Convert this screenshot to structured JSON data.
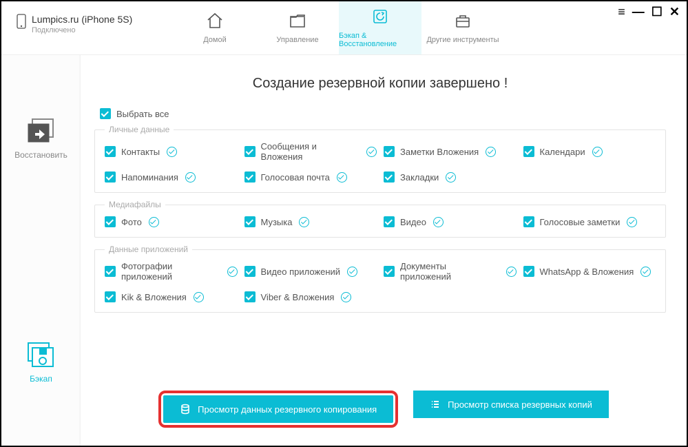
{
  "device": {
    "name": "Lumpics.ru (iPhone 5S)",
    "status": "Подключено"
  },
  "nav": {
    "home": "Домой",
    "manage": "Управление",
    "backup": "Бэкап & Восстановление",
    "tools": "Другие инструменты"
  },
  "sidebar": {
    "restore": "Восстановить",
    "backup": "Бэкап"
  },
  "headline": "Создание резервной копии завершено !",
  "select_all": "Выбрать все",
  "groups": {
    "personal": {
      "title": "Личные данные",
      "items": {
        "contacts": "Контакты",
        "messages": "Сообщения и Вложения",
        "notes_att": "Заметки Вложения",
        "calendars": "Календари",
        "reminders": "Напоминания",
        "voicemail": "Голосовая почта",
        "bookmarks": "Закладки"
      }
    },
    "media": {
      "title": "Медиафайлы",
      "items": {
        "photo": "Фото",
        "music": "Музыка",
        "video": "Видео",
        "voicenotes": "Голосовые заметки"
      }
    },
    "apps": {
      "title": "Данные приложений",
      "items": {
        "app_photos": "Фотографии приложений",
        "app_video": "Видео приложений",
        "app_docs": "Документы приложений",
        "whatsapp": "WhatsApp & Вложения",
        "kik": "Kik & Вложения",
        "viber": "Viber & Вложения"
      }
    }
  },
  "buttons": {
    "view_data": "Просмотр данных резервного копирования",
    "view_list": "Просмотр списка резервных копий"
  }
}
